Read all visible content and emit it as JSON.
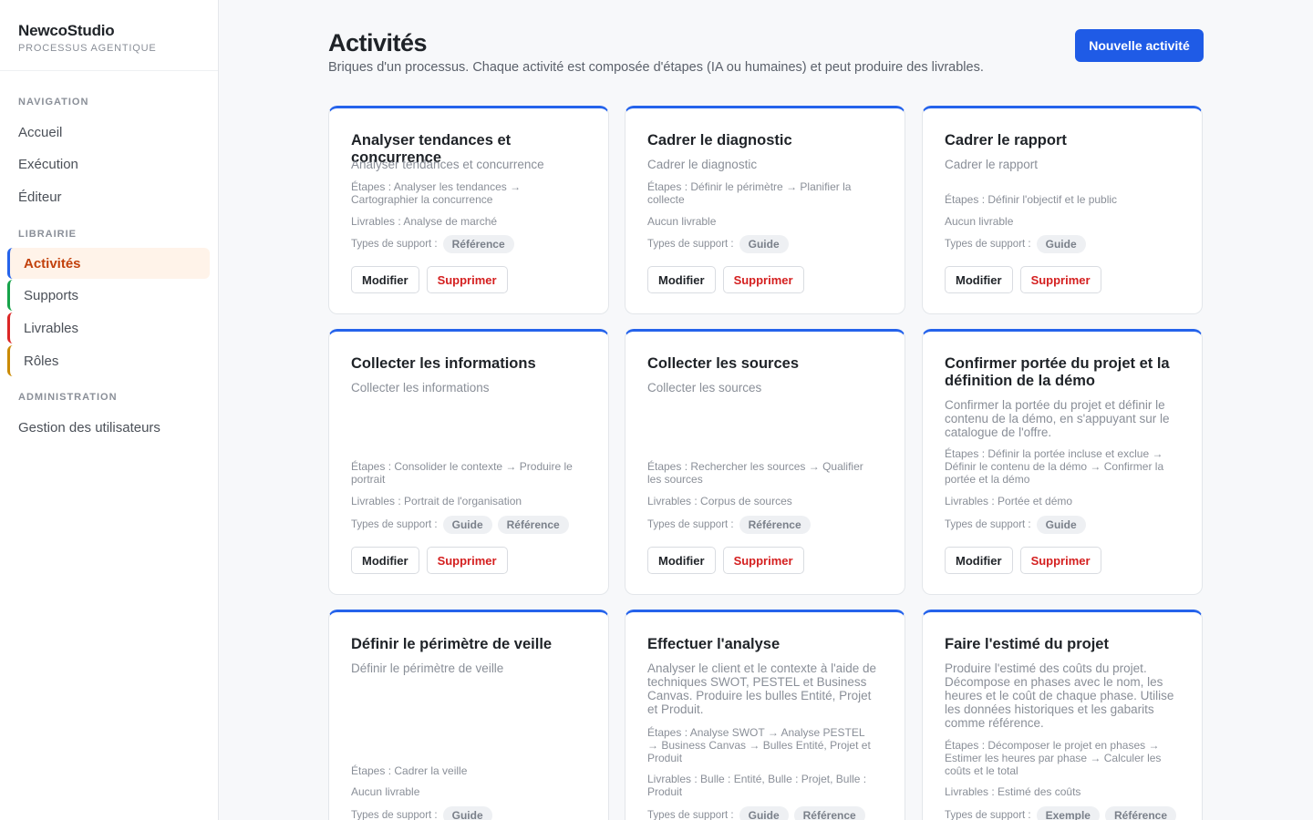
{
  "brand": {
    "name": "NewcoStudio",
    "subtitle": "PROCESSUS AGENTIQUE"
  },
  "sidebar": {
    "sections": {
      "navigation": "NAVIGATION",
      "library": "LIBRAIRIE",
      "admin": "ADMINISTRATION"
    },
    "nav": [
      "Accueil",
      "Exécution",
      "Éditeur"
    ],
    "library": [
      {
        "label": "Activités",
        "color": "#2563eb",
        "active": true
      },
      {
        "label": "Supports",
        "color": "#16a34a"
      },
      {
        "label": "Livrables",
        "color": "#dc2626"
      },
      {
        "label": "Rôles",
        "color": "#ca8a04"
      }
    ],
    "admin": [
      "Gestion des utilisateurs"
    ]
  },
  "header": {
    "title": "Activités",
    "description": "Briques d'un processus. Chaque activité est composée d'étapes (IA ou humaines) et peut produire des livrables.",
    "new_button": "Nouvelle activité"
  },
  "labels": {
    "support_prefix": "Types de support :",
    "edit": "Modifier",
    "delete": "Supprimer"
  },
  "cards": [
    {
      "title": "Analyser tendances et concurrence",
      "description": "Analyser tendances et concurrence",
      "steps": "Étapes : Analyser les tendances → Cartographier la concurrence",
      "deliverables": "Livrables : Analyse de marché",
      "supports": [
        "Référence"
      ]
    },
    {
      "title": "Cadrer le diagnostic",
      "description": "Cadrer le diagnostic",
      "steps": "Étapes : Définir le périmètre → Planifier la collecte",
      "deliverables": "Aucun livrable",
      "supports": [
        "Guide"
      ]
    },
    {
      "title": "Cadrer le rapport",
      "description": "Cadrer le rapport",
      "steps": "Étapes : Définir l'objectif et le public",
      "deliverables": "Aucun livrable",
      "supports": [
        "Guide"
      ]
    },
    {
      "title": "Collecter les informations",
      "description": "Collecter les informations",
      "steps": "Étapes : Consolider le contexte → Produire le portrait",
      "deliverables": "Livrables : Portrait de l'organisation",
      "supports": [
        "Guide",
        "Référence"
      ]
    },
    {
      "title": "Collecter les sources",
      "description": "Collecter les sources",
      "steps": "Étapes : Rechercher les sources → Qualifier les sources",
      "deliverables": "Livrables : Corpus de sources",
      "supports": [
        "Référence"
      ]
    },
    {
      "title": "Confirmer portée du projet et la définition de la démo",
      "description": "Confirmer la portée du projet et définir le contenu de la démo, en s'appuyant sur le catalogue de l'offre.",
      "steps": "Étapes : Définir la portée incluse et exclue → Définir le contenu de la démo → Confirmer la portée et la démo",
      "deliverables": "Livrables : Portée et démo",
      "supports": [
        "Guide"
      ]
    },
    {
      "title": "Définir le périmètre de veille",
      "description": "Définir le périmètre de veille",
      "steps": "Étapes : Cadrer la veille",
      "deliverables": "Aucun livrable",
      "supports": [
        "Guide"
      ]
    },
    {
      "title": "Effectuer l'analyse",
      "description": "Analyser le client et le contexte à l'aide de techniques SWOT, PESTEL et Business Canvas. Produire les bulles Entité, Projet et Produit.",
      "steps": "Étapes : Analyse SWOT → Analyse PESTEL → Business Canvas → Bulles Entité, Projet et Produit",
      "deliverables": "Livrables : Bulle : Entité, Bulle : Projet, Bulle : Produit",
      "supports": [
        "Guide",
        "Référence"
      ]
    },
    {
      "title": "Faire l'estimé du projet",
      "description": "Produire l'estimé des coûts du projet. Décompose en phases avec le nom, les heures et le coût de chaque phase. Utilise les données historiques et les gabarits comme référence.",
      "steps": "Étapes : Décomposer le projet en phases → Estimer les heures par phase → Calculer les coûts et le total",
      "deliverables": "Livrables : Estimé des coûts",
      "supports": [
        "Exemple",
        "Référence"
      ]
    }
  ]
}
